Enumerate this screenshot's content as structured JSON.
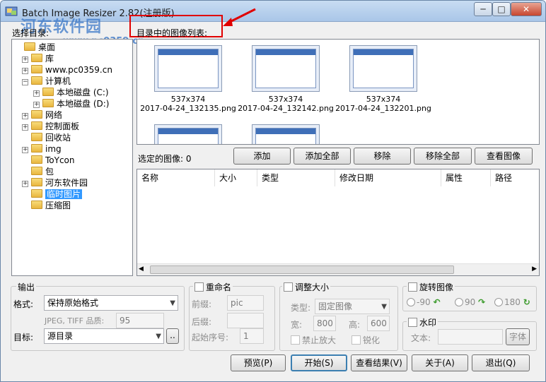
{
  "window": {
    "title": "Batch Image Resizer 2.82(注册版)",
    "minimize": "─",
    "maximize": "□",
    "close": "✕"
  },
  "watermark": {
    "site": "河东软件园",
    "url": "www.pc0359.cn"
  },
  "left_panel": {
    "label": "选择目录:"
  },
  "tree": [
    {
      "label": "桌面",
      "icon": "desktop-icon",
      "expander": ""
    },
    {
      "label": "库",
      "icon": "library-icon",
      "expander": "+"
    },
    {
      "label": "www.pc0359.cn",
      "icon": "user-folder-icon",
      "expander": "+"
    },
    {
      "label": "计算机",
      "icon": "computer-icon",
      "expander": "−"
    },
    {
      "label": "本地磁盘 (C:)",
      "icon": "drive-c-icon",
      "expander": "+"
    },
    {
      "label": "本地磁盘 (D:)",
      "icon": "drive-d-icon",
      "expander": "+"
    },
    {
      "label": "网络",
      "icon": "network-icon",
      "expander": "+"
    },
    {
      "label": "控制面板",
      "icon": "control-panel-icon",
      "expander": "+"
    },
    {
      "label": "回收站",
      "icon": "recycle-bin-icon",
      "expander": ""
    },
    {
      "label": "img",
      "icon": "folder-icon",
      "expander": "+"
    },
    {
      "label": "ToYcon",
      "icon": "folder-icon",
      "expander": ""
    },
    {
      "label": "包",
      "icon": "folder-icon",
      "expander": ""
    },
    {
      "label": "河东软件园",
      "icon": "folder-icon",
      "expander": "+"
    },
    {
      "label": "临时图片",
      "icon": "folder-icon",
      "expander": "",
      "selected": true
    },
    {
      "label": "压缩图",
      "icon": "folder-icon",
      "expander": ""
    }
  ],
  "image_list": {
    "label": "目录中的图像列表:",
    "items": [
      {
        "size": "537x374",
        "name": "2017-04-24_132135.png"
      },
      {
        "size": "537x374",
        "name": "2017-04-24_132142.png"
      },
      {
        "size": "537x374",
        "name": "2017-04-24_132201.png"
      }
    ]
  },
  "selected": {
    "label_prefix": "选定的图像:",
    "count": "0",
    "buttons": {
      "add": "添加",
      "add_all": "添加全部",
      "remove": "移除",
      "remove_all": "移除全部",
      "view": "查看图像"
    },
    "columns": [
      "名称",
      "大小",
      "类型",
      "修改日期",
      "属性",
      "路径"
    ]
  },
  "output": {
    "legend": "输出",
    "format_label": "格式:",
    "format_value": "保持原始格式",
    "quality_label": "JPEG, TIFF 品质:",
    "quality_value": "95",
    "target_label": "目标:",
    "target_value": "源目录",
    "browse": ".."
  },
  "rename": {
    "legend": "重命名",
    "prefix_label": "前缀:",
    "prefix_value": "pic",
    "suffix_label": "后缀:",
    "suffix_value": "",
    "start_label": "起始序号:",
    "start_value": "1"
  },
  "resize": {
    "legend": "调整大小",
    "type_label": "类型:",
    "type_value": "固定图像",
    "width_label": "宽:",
    "width_value": "800",
    "height_label": "高:",
    "height_value": "600",
    "no_enlarge": "禁止放大",
    "sharpen": "锐化"
  },
  "rotate": {
    "legend": "旋转图像",
    "opt1": "-90",
    "opt2": "90",
    "opt3": "180"
  },
  "watermark_group": {
    "legend": "水印",
    "text_label": "文本:",
    "text_value": "",
    "font": "字体"
  },
  "bottom_buttons": {
    "preview": "预览(P)",
    "start": "开始(S)",
    "view_result": "查看结果(V)",
    "about": "关于(A)",
    "exit": "退出(Q)"
  },
  "colors": {
    "accent": "#3399ff",
    "highlight": "#e00000"
  }
}
